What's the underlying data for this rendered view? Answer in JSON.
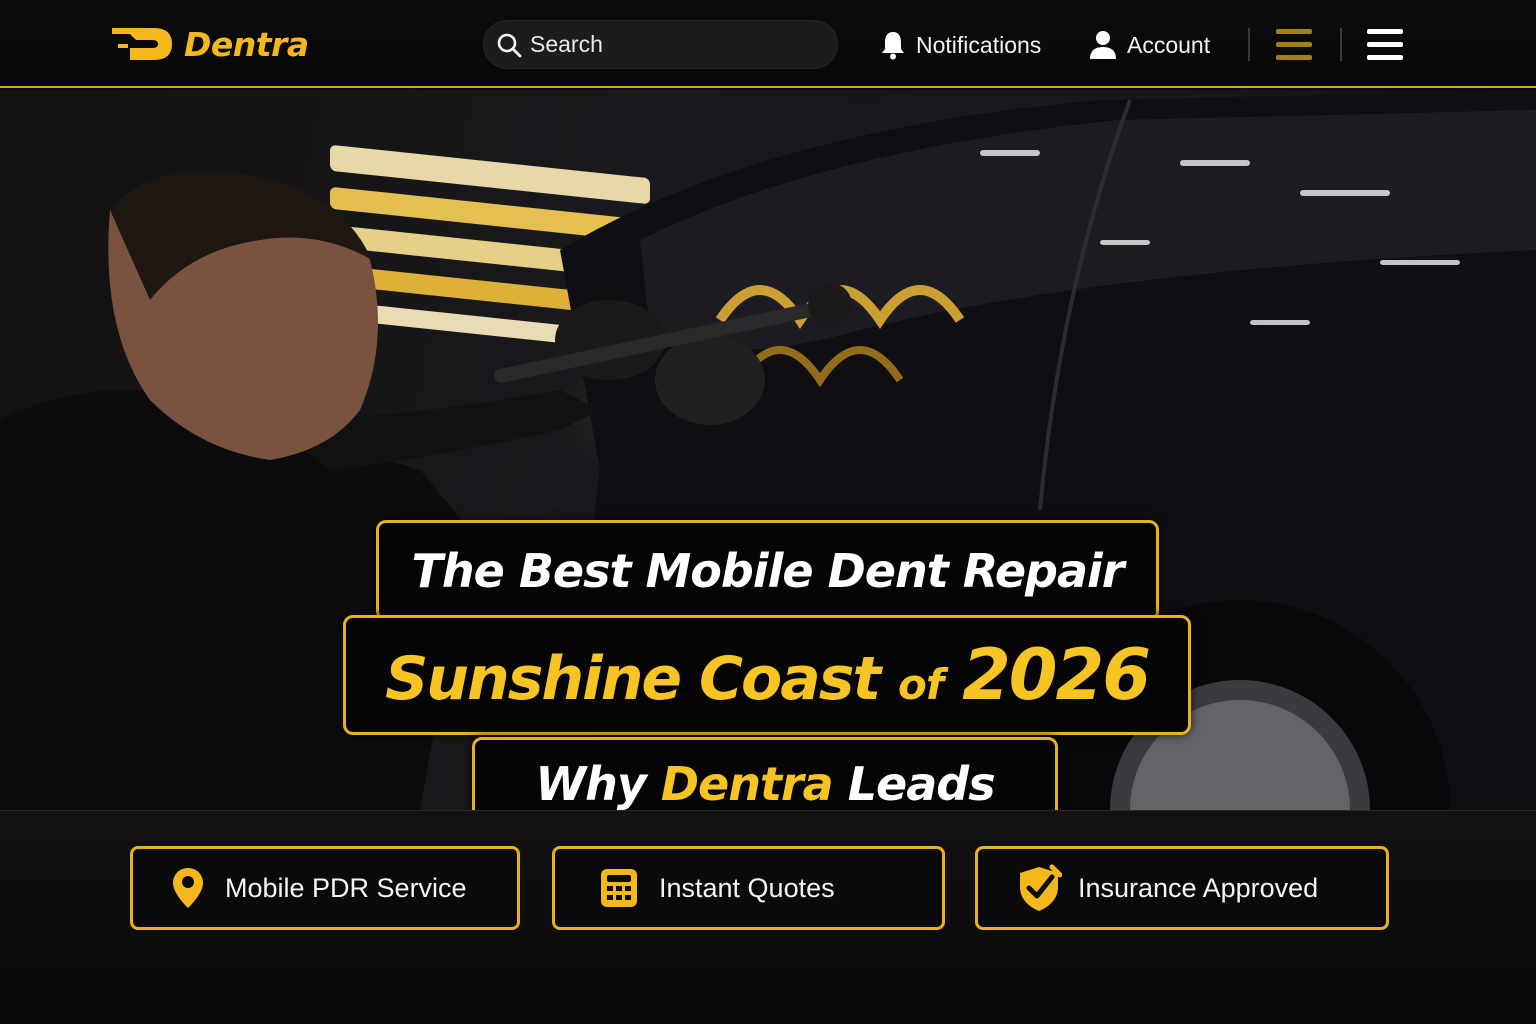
{
  "brand": {
    "name": "Dentra",
    "accent": "#f5b81c"
  },
  "header": {
    "search": {
      "placeholder": "Search",
      "icon": "search-icon"
    },
    "notifications": {
      "label": "Notifications",
      "icon": "bell-icon"
    },
    "account": {
      "label": "Account",
      "icon": "user-icon"
    },
    "menus": [
      "menu-icon-gold",
      "menu-icon-white"
    ]
  },
  "hero": {
    "line1": "The Best Mobile Dent Repair",
    "line2_main": "Sunshine Coast",
    "line2_of": "of",
    "line2_year": "2026",
    "line3_pre": "Why",
    "line3_brand": "Dentra",
    "line3_post": "Leads"
  },
  "features": [
    {
      "label": "Mobile PDR Service",
      "icon": "map-pin-icon"
    },
    {
      "label": "Instant Quotes",
      "icon": "calculator-icon"
    },
    {
      "label": "Insurance Approved",
      "icon": "shield-check-icon"
    }
  ]
}
